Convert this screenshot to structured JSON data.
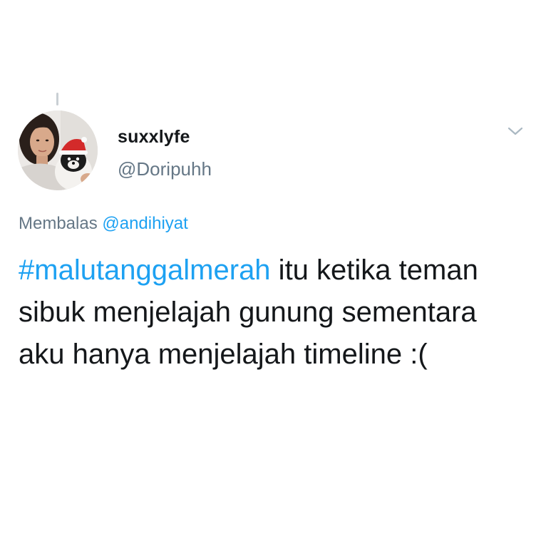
{
  "tweet": {
    "display_name": "suxxlyfe",
    "handle": "@Doripuhh",
    "reply_prefix": "Membalas ",
    "reply_mention": "@andihiyat",
    "hashtag": "#malutanggalmerah",
    "text_after_hashtag": " itu ketika teman sibuk menjelajah gunung sementara aku hanya menjelajah timeline :("
  },
  "icons": {
    "avatar": "user-avatar-photo",
    "menu": "chevron-down-icon"
  },
  "colors": {
    "link": "#1da1f2",
    "secondary_text": "#657786",
    "primary_text": "#14171a",
    "chevron": "#aab8c2",
    "thread_line": "#c9cfd4"
  }
}
